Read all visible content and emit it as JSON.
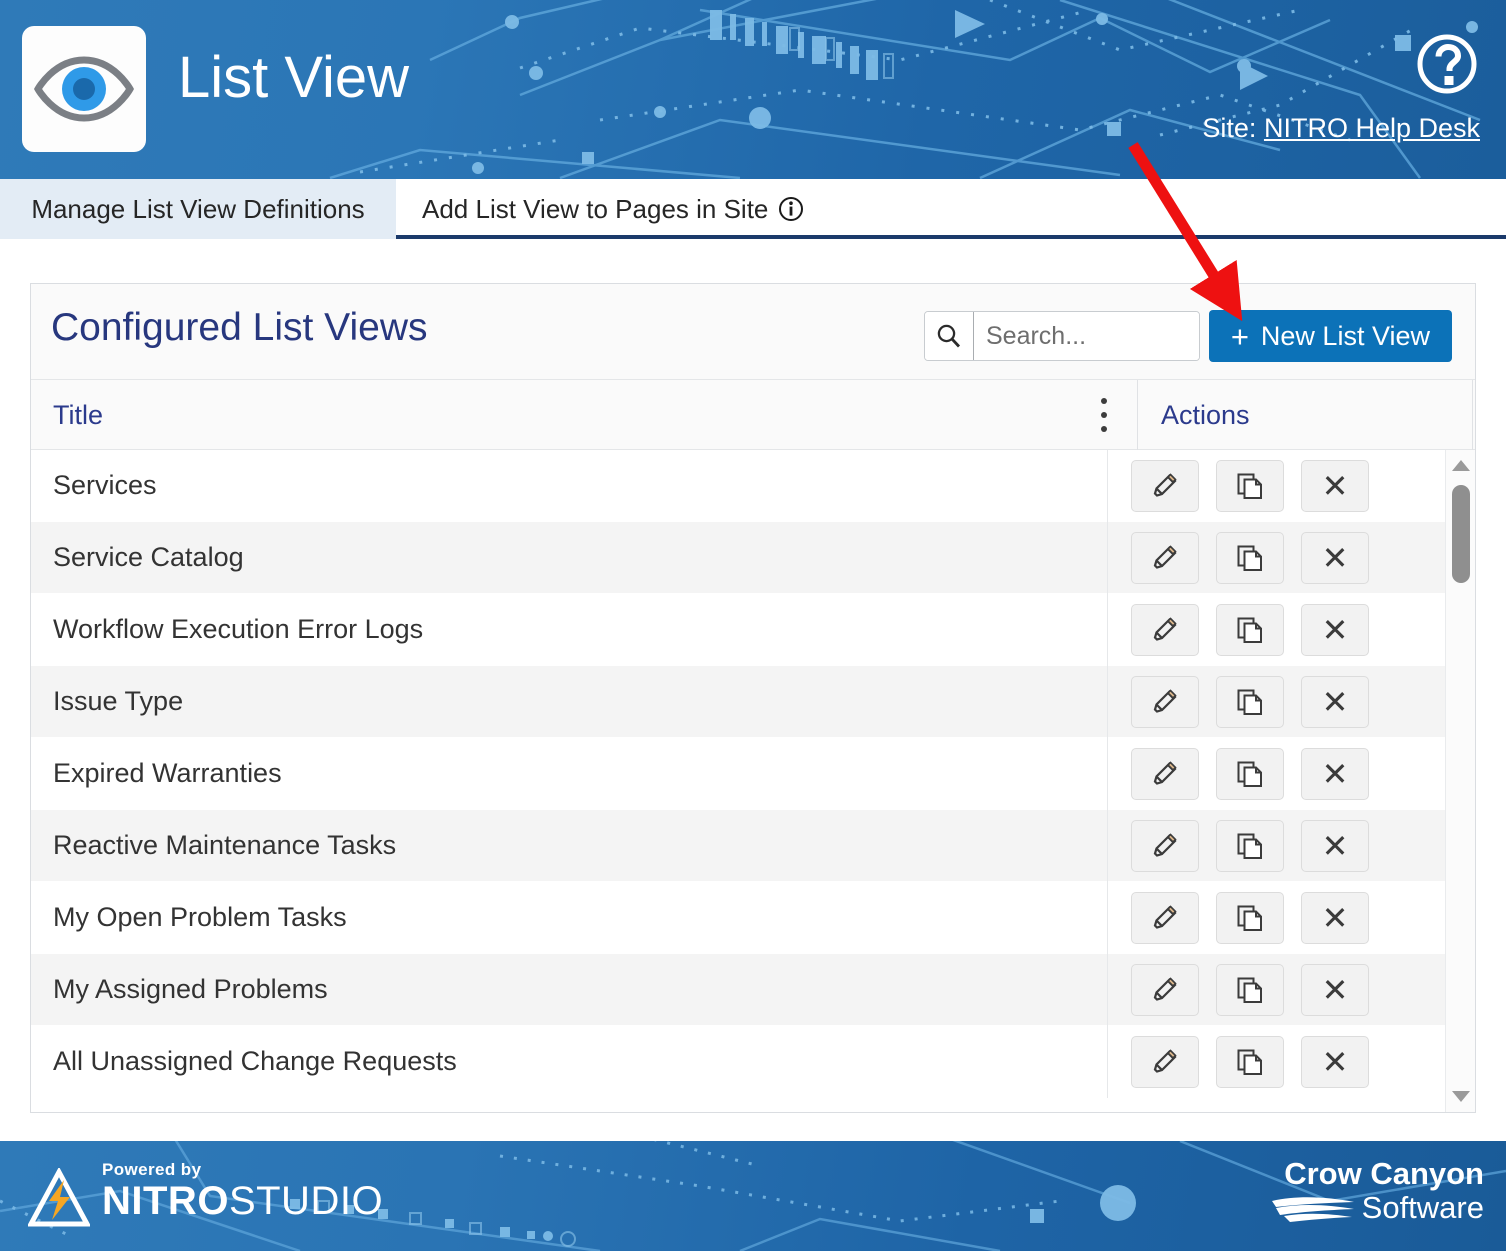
{
  "header": {
    "title": "List View",
    "app_icon": "eye-icon",
    "help_icon": "help-circle-icon",
    "site_label": "Site:",
    "site_name": "NITRO Help Desk",
    "bg_color": "#2b76b6"
  },
  "tabs": [
    {
      "label": "Manage List View Definitions",
      "active": true
    },
    {
      "label": "Add List View to Pages in Site",
      "active": false,
      "icon": "info-icon"
    }
  ],
  "card": {
    "title": "Configured List Views",
    "title_color": "#27377e",
    "search": {
      "icon": "search-icon",
      "placeholder": "Search...",
      "value": ""
    },
    "new_button": {
      "plus": "+",
      "label": "New List View",
      "color": "#0c72b8"
    }
  },
  "table": {
    "columns": [
      {
        "label": "Title",
        "menu_icon": "dots-vertical-icon"
      },
      {
        "label": "Actions"
      }
    ],
    "row_actions": [
      {
        "name": "edit",
        "icon": "pencil-icon"
      },
      {
        "name": "copy",
        "icon": "copy-icon"
      },
      {
        "name": "delete",
        "icon": "close-x-icon"
      }
    ],
    "rows": [
      {
        "title": "Services"
      },
      {
        "title": "Service Catalog"
      },
      {
        "title": "Workflow Execution Error Logs"
      },
      {
        "title": "Issue Type"
      },
      {
        "title": "Expired Warranties"
      },
      {
        "title": "Reactive Maintenance Tasks"
      },
      {
        "title": "My Open Problem Tasks"
      },
      {
        "title": "My Assigned Problems"
      },
      {
        "title": "All Unassigned Change Requests"
      }
    ],
    "scrollbar": {
      "up_icon": "caret-up-icon",
      "down_icon": "caret-down-icon"
    }
  },
  "footer": {
    "nitro": {
      "powered_by": "Powered by",
      "word_bold": "NITRO",
      "word_light": "STUDIO",
      "logo_icon": "nitro-bolt-icon"
    },
    "crow": {
      "line1": "Crow Canyon",
      "line2": "Software",
      "logo_icon": "crow-wave-icon"
    }
  },
  "annotation": {
    "type": "arrow",
    "color": "#ee1111",
    "points_to": "new-list-view-button"
  }
}
